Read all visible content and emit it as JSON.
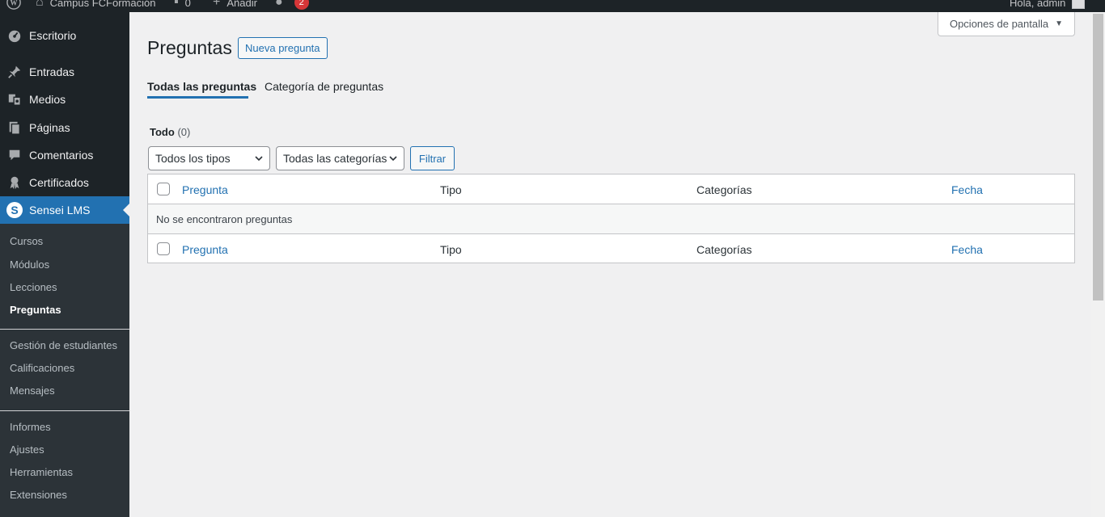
{
  "adminbar": {
    "site_name": "Campus FCFormación",
    "comments_count": "0",
    "new_label": "Añadir",
    "updates_count": "2",
    "greeting": "Hola, admin"
  },
  "sidebar": {
    "menu": [
      {
        "label": "Escritorio",
        "icon": "dashboard-icon"
      },
      {
        "label": "Entradas",
        "icon": "pin-icon"
      },
      {
        "label": "Medios",
        "icon": "media-icon"
      },
      {
        "label": "Páginas",
        "icon": "pages-icon"
      },
      {
        "label": "Comentarios",
        "icon": "comment-icon"
      },
      {
        "label": "Certificados",
        "icon": "certificate-icon"
      },
      {
        "label": "Sensei LMS",
        "icon": "sensei-logo-icon"
      }
    ],
    "submenu": [
      "Cursos",
      "Módulos",
      "Lecciones",
      "Preguntas",
      "Gestión de estudiantes",
      "Calificaciones",
      "Mensajes",
      "Informes",
      "Ajustes",
      "Herramientas",
      "Extensiones"
    ]
  },
  "screen_options": "Opciones de pantalla",
  "page": {
    "title": "Preguntas",
    "new_button": "Nueva pregunta",
    "tabs": [
      "Todas las preguntas",
      "Categoría de preguntas"
    ],
    "filter_all_label": "Todo",
    "filter_all_count": "(0)"
  },
  "filters": {
    "type_select": "Todos los tipos",
    "category_select": "Todas las categorías",
    "filter_button": "Filtrar"
  },
  "table": {
    "columns": [
      "Pregunta",
      "Tipo",
      "Categorías",
      "Fecha"
    ],
    "empty_message": "No se encontraron preguntas"
  },
  "colors": {
    "accent": "#2271b1",
    "sidebar_bg": "#1d2327",
    "badge": "#d63638"
  }
}
